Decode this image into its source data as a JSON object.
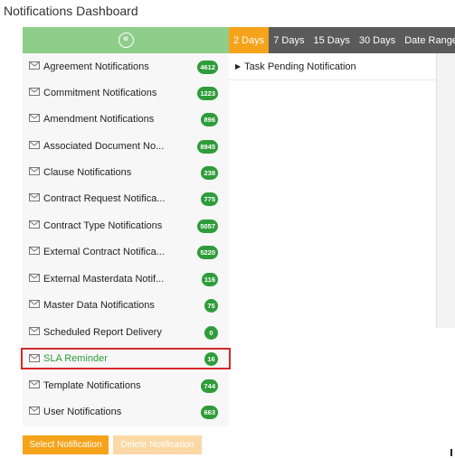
{
  "page_title": "Notifications Dashboard",
  "sidebar_toggle_glyph": "«",
  "tabs": [
    {
      "label": "2 Days",
      "active": true
    },
    {
      "label": "7 Days",
      "active": false
    },
    {
      "label": "15 Days",
      "active": false
    },
    {
      "label": "30 Days",
      "active": false
    },
    {
      "label": "Date Range",
      "active": false
    }
  ],
  "sidebar": {
    "items": [
      {
        "label": "Agreement Notifications",
        "count": "4612"
      },
      {
        "label": "Commitment Notifications",
        "count": "1223"
      },
      {
        "label": "Amendment Notifications",
        "count": "896"
      },
      {
        "label": "Associated Document No...",
        "count": "8945"
      },
      {
        "label": "Clause Notifications",
        "count": "238"
      },
      {
        "label": "Contract Request Notifica...",
        "count": "775"
      },
      {
        "label": "Contract Type Notifications",
        "count": "5057"
      },
      {
        "label": "External Contract Notifica...",
        "count": "5220"
      },
      {
        "label": "External Masterdata Notif...",
        "count": "116"
      },
      {
        "label": "Master Data Notifications",
        "count": "75"
      },
      {
        "label": "Scheduled Report Delivery",
        "count": "0"
      },
      {
        "label": "SLA Reminder",
        "count": "16"
      },
      {
        "label": "Template Notifications",
        "count": "744"
      },
      {
        "label": "User Notifications",
        "count": "663"
      }
    ],
    "selected_index": 11
  },
  "content": {
    "row_label": "Task Pending Notification",
    "caret_glyph": "▶"
  },
  "buttons": {
    "select_label": "Select Notification",
    "delete_label": "Delete Notification"
  },
  "colors": {
    "accent_orange": "#f5a31a",
    "header_green": "#8fce8a",
    "badge_green": "#2e9c3a",
    "selection_red": "#d42a2a",
    "tabbar_gray": "#5a5a5a"
  },
  "icons": {
    "item_icon": "envelope-icon",
    "toggle_icon": "double-chevron-left-icon",
    "expand_icon": "caret-right-icon"
  }
}
